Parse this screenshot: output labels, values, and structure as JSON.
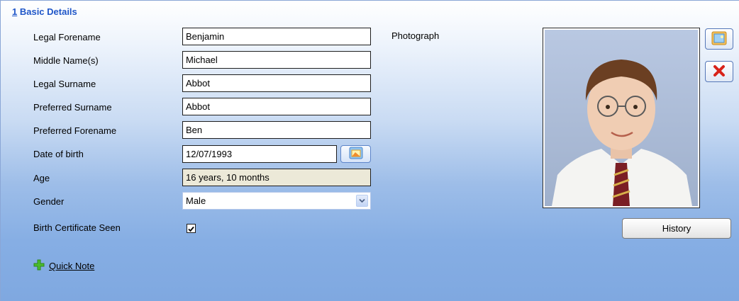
{
  "section": {
    "number": "1",
    "title": " Basic Details"
  },
  "fields": {
    "legal_forename": {
      "label": "Legal Forename",
      "value": "Benjamin"
    },
    "middle_names": {
      "label": "Middle Name(s)",
      "value": "Michael"
    },
    "legal_surname": {
      "label": "Legal Surname",
      "value": "Abbot"
    },
    "preferred_surname": {
      "label": "Preferred Surname",
      "value": "Abbot"
    },
    "preferred_forename": {
      "label": "Preferred Forename",
      "value": "Ben"
    },
    "date_of_birth": {
      "label": "Date of birth",
      "value": "12/07/1993"
    },
    "age": {
      "label": "Age",
      "value": "16 years, 10 months"
    },
    "gender": {
      "label": "Gender",
      "value": "Male"
    },
    "birth_certificate": {
      "label": "Birth Certificate Seen",
      "checked": true
    }
  },
  "quick_note": {
    "label": "Quick Note",
    "icon": "plus-icon"
  },
  "photograph": {
    "label": "Photograph"
  },
  "buttons": {
    "history": "History",
    "select_photo_icon": "image-icon",
    "remove_photo_icon": "close-icon",
    "calendar_icon": "calendar-icon"
  },
  "colors": {
    "section_title": "#1f56c8",
    "accent_plus": "#3ca62a",
    "remove_red": "#d8231a"
  }
}
